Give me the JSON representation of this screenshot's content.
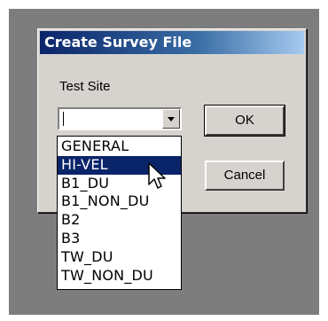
{
  "dialog": {
    "title": "Create Survey File",
    "label": "Test Site",
    "combo_value": "",
    "ok_label": "OK",
    "cancel_label": "Cancel"
  },
  "dropdown": {
    "selected_index": 1,
    "items": [
      "GENERAL",
      "HI-VEL",
      "B1_DU",
      "B1_NON_DU",
      "B2",
      "B3",
      "TW_DU",
      "TW_NON_DU"
    ]
  },
  "icons": {
    "dropdown_arrow": "chevron-down-icon",
    "pointer": "mouse-pointer-icon"
  },
  "colors": {
    "titlebar_start": "#0a246a",
    "titlebar_end": "#a6caf0",
    "selection": "#0a246a",
    "dialog_bg": "#d6d3ce",
    "desktop_bg": "#7d7d7d"
  }
}
